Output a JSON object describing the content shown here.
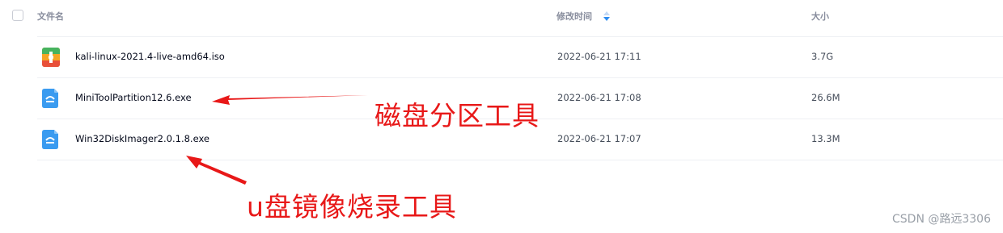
{
  "header": {
    "name_label": "文件名",
    "modified_label": "修改时间",
    "size_label": "大小"
  },
  "files": [
    {
      "name": "kali-linux-2021.4-live-amd64.iso",
      "date": "2022-06-21 17:11",
      "size": "3.7G",
      "icon": "archive-icon"
    },
    {
      "name": "MiniToolPartition12.6.exe",
      "date": "2022-06-21 17:08",
      "size": "26.6M",
      "icon": "executable-icon"
    },
    {
      "name": "Win32DiskImager2.0.1.8.exe",
      "date": "2022-06-21 17:07",
      "size": "13.3M",
      "icon": "executable-icon"
    }
  ],
  "annotations": {
    "partition_tool": "磁盘分区工具",
    "usb_image_tool": "u盘镜像烧录工具"
  },
  "watermark": "CSDN @路远3306",
  "colors": {
    "annotation": "#e81818",
    "exe_icon": "#3a9bf0",
    "header_text": "#878c9c",
    "row_border": "#eef0f4"
  }
}
